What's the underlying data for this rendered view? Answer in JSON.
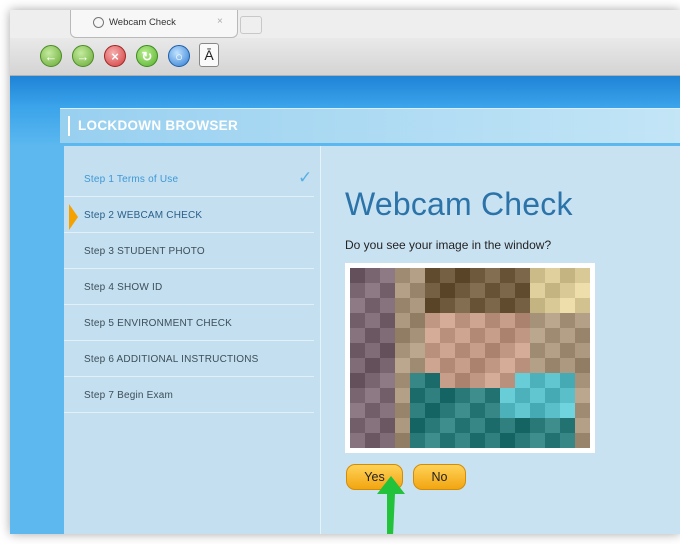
{
  "browser": {
    "tab_title": "Webcam Check",
    "tab_close": "×",
    "toolbar_font_glyph": "Ā",
    "icons": [
      "back-icon",
      "forward-icon",
      "stop-icon",
      "reload-icon",
      "globe-icon",
      "font-icon"
    ]
  },
  "app": {
    "brand_title": "LOCKDOWN BROWSER"
  },
  "steps": [
    {
      "label": "Step 1   Terms of Use",
      "state": "done"
    },
    {
      "label": "Step 2   WEBCAM CHECK",
      "state": "active"
    },
    {
      "label": "Step 3   STUDENT PHOTO",
      "state": "pending"
    },
    {
      "label": "Step 4   SHOW ID",
      "state": "pending"
    },
    {
      "label": "Step 5   ENVIRONMENT CHECK",
      "state": "pending"
    },
    {
      "label": "Step 6   ADDITIONAL INSTRUCTIONS",
      "state": "pending"
    },
    {
      "label": "Step 7   Begin Exam",
      "state": "pending"
    }
  ],
  "main": {
    "title": "Webcam Check",
    "question": "Do you see your image in the window?",
    "yes_label": "Yes",
    "no_label": "No"
  },
  "colors": {
    "accent": "#f5a100",
    "title_blue": "#2b73a8",
    "arrow_green": "#22c23a",
    "page_blue": "#3aa3ea"
  }
}
